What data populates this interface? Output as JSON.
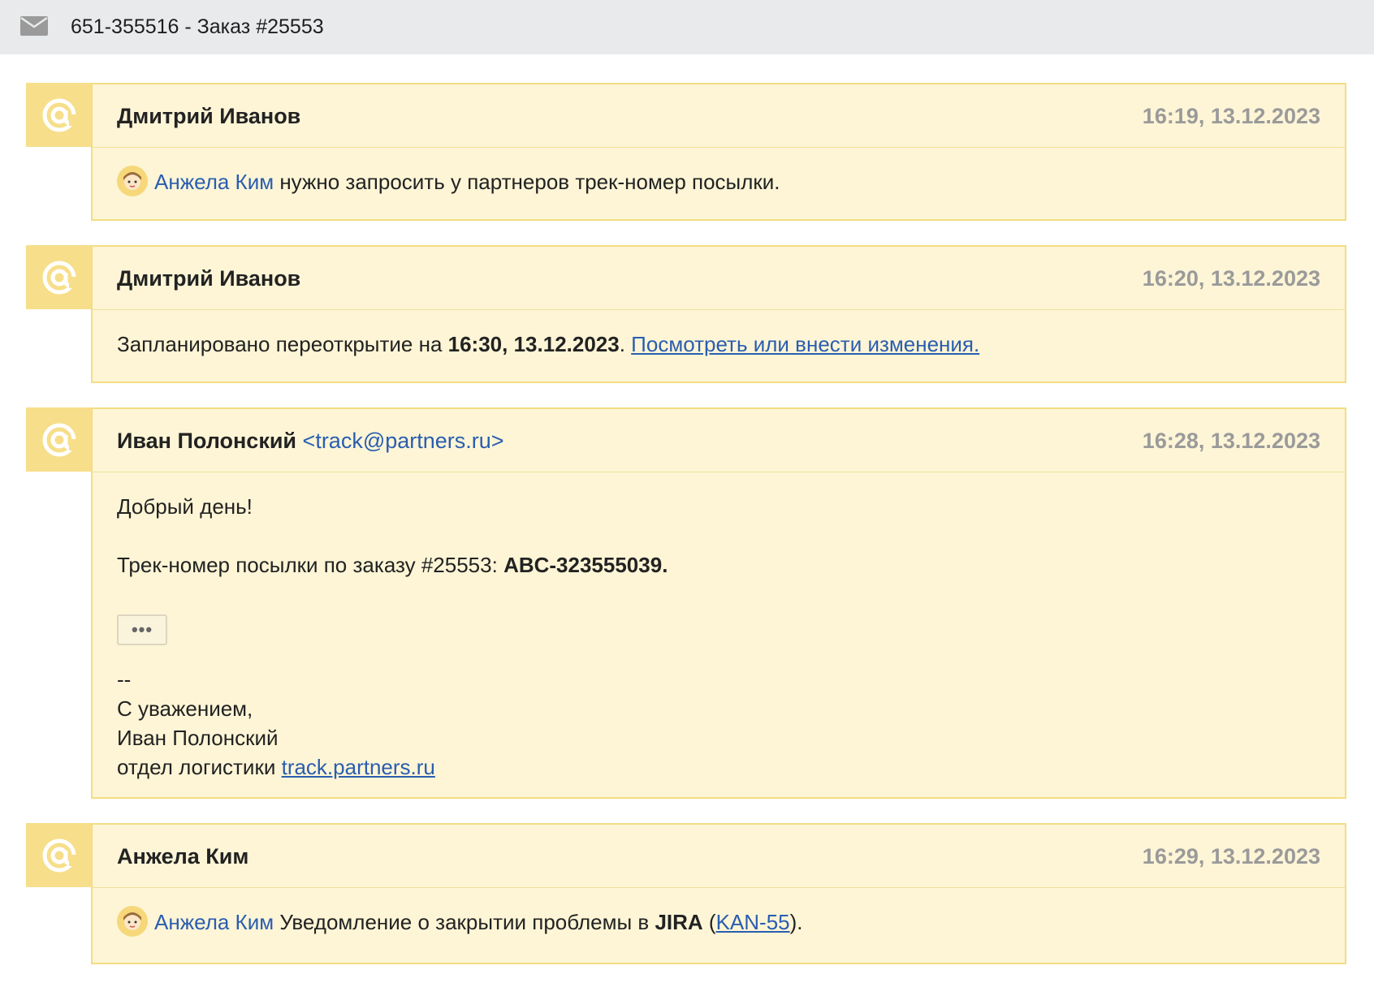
{
  "header": {
    "icon": "mail-icon",
    "title": "651-355516 - Заказ #25553"
  },
  "messages": [
    {
      "author": "Дмитрий Иванов",
      "time": "16:19, 13.12.2023",
      "mention": "Анжела Ким",
      "text": " нужно запросить у партнеров трек-номер посылки."
    },
    {
      "author": "Дмитрий Иванов",
      "time": "16:20, 13.12.2023",
      "text_before": "Запланировано переоткрытие на ",
      "bold": "16:30, 13.12.2023",
      "text_after": ". ",
      "link": "Посмотреть или внести изменения."
    },
    {
      "author": "Иван Полонский",
      "email": "<track@partners.ru>",
      "time": "16:28, 13.12.2023",
      "greeting": "Добрый день!",
      "track_text": "Трек-номер посылки по заказу #25553: ",
      "track_number": "ABC-323555039.",
      "more_label": "•••",
      "sig_dash": "--",
      "sig_regards": "С уважением,",
      "sig_name": "Иван Полонский",
      "sig_dept": "отдел логистики ",
      "sig_link": "track.partners.ru"
    },
    {
      "author": "Анжела Ким",
      "time": "16:29, 13.12.2023",
      "mention": "Анжела Ким",
      "text": " Уведомление о закрытии проблемы в ",
      "bold": "JIRA",
      "paren_open": " (",
      "link": "KAN-55",
      "paren_close": ")."
    }
  ],
  "colors": {
    "badge": "#f7de8a",
    "card": "#fdf5d6",
    "link": "#2a5db0",
    "time": "#9a9a9a"
  }
}
